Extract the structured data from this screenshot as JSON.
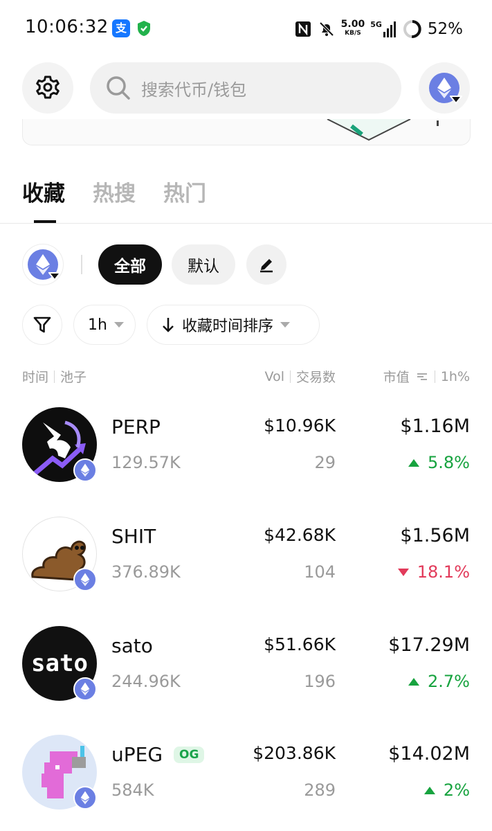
{
  "status_bar": {
    "time": "10:06:32",
    "app_icon_alipay": "支",
    "net_speed_value": "5.00",
    "net_speed_unit": "KB/S",
    "network_label": "5G",
    "battery": "52%"
  },
  "header": {
    "search_placeholder": "搜索代币/钱包",
    "settings_icon": "gear-icon",
    "chain_icon": "ethereum-icon"
  },
  "tabs": [
    {
      "label": "收藏",
      "active": true
    },
    {
      "label": "热搜",
      "active": false
    },
    {
      "label": "热门",
      "active": false
    }
  ],
  "filters": {
    "chip_all": "全部",
    "chip_default": "默认",
    "timeframe": "1h",
    "sort": "收藏时间排序"
  },
  "columns": {
    "time": "时间",
    "pool": "池子",
    "vol": "Vol",
    "txns": "交易数",
    "mcap": "市值",
    "change": "1h%"
  },
  "colors": {
    "up": "#17a33f",
    "down": "#e23a5a",
    "eth": "#6b7fe3",
    "og_badge_bg": "#dff6e6"
  },
  "tokens": [
    {
      "symbol": "PERP",
      "pool": "129.57K",
      "vol": "$10.96K",
      "txns": "29",
      "mcap": "$1.16M",
      "change": "5.8%",
      "direction": "up",
      "og": ""
    },
    {
      "symbol": "SHIT",
      "pool": "376.89K",
      "vol": "$42.68K",
      "txns": "104",
      "mcap": "$1.56M",
      "change": "18.1%",
      "direction": "down",
      "og": ""
    },
    {
      "symbol": "sato",
      "pool": "244.96K",
      "vol": "$51.66K",
      "txns": "196",
      "mcap": "$17.29M",
      "change": "2.7%",
      "direction": "up",
      "og": "",
      "logo_text": "sato"
    },
    {
      "symbol": "uPEG",
      "pool": "584K",
      "vol": "$203.86K",
      "txns": "289",
      "mcap": "$14.02M",
      "change": "2%",
      "direction": "up",
      "og": "OG"
    }
  ]
}
